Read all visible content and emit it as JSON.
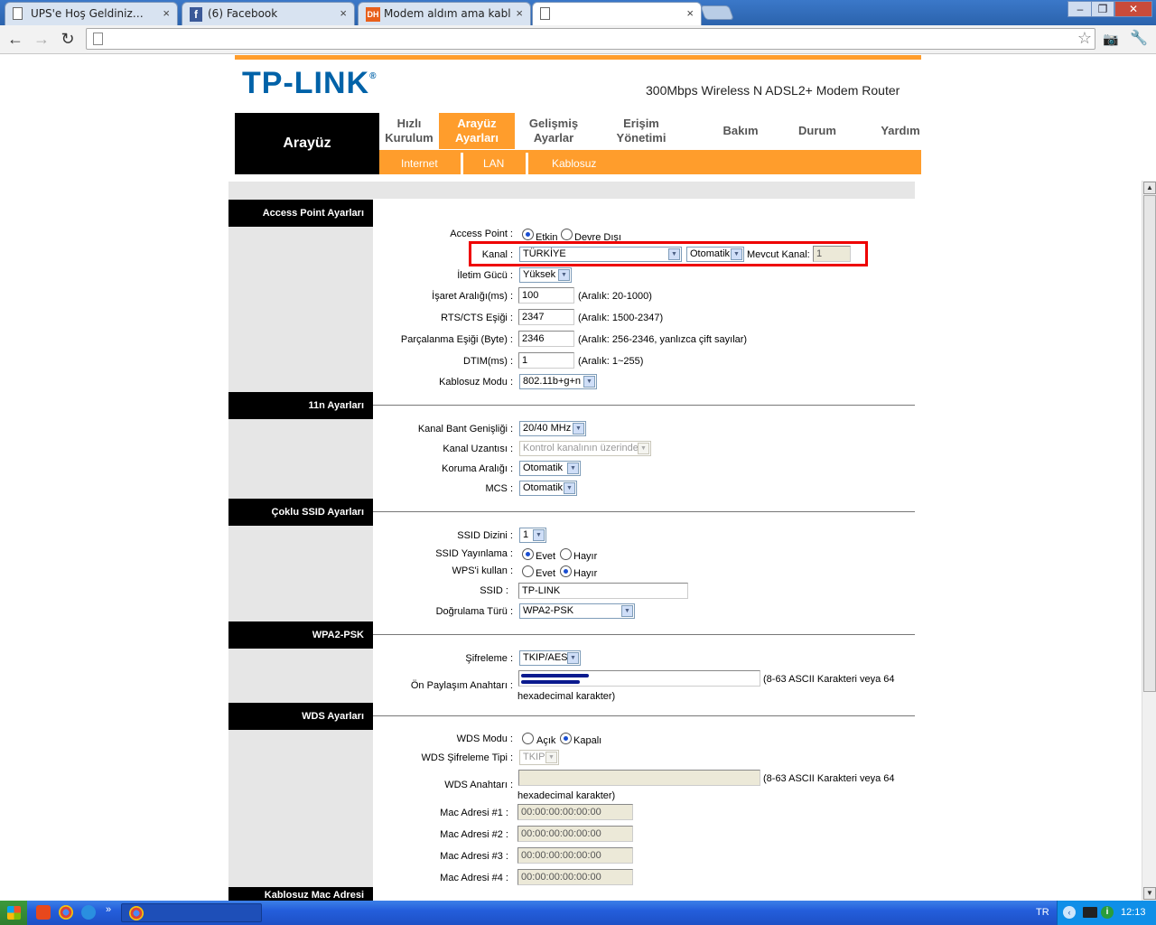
{
  "browser": {
    "tabs": [
      {
        "title": "UPS'e Hoş Geldiniz…",
        "close": "×"
      },
      {
        "title": "(6) Facebook",
        "close": "×"
      },
      {
        "title": "Modem aldım ama kablosuz o",
        "close": "×"
      },
      {
        "title": "",
        "close": "×"
      }
    ],
    "window_buttons": [
      "–",
      "❐",
      "✕"
    ],
    "back": "←",
    "forward": "→",
    "reload": "↻",
    "address": "",
    "star": "☆"
  },
  "router": {
    "logo": "TP-LINK",
    "logo_mark": "®",
    "model": "300Mbps Wireless N ADSL2+ Modem Router",
    "section_title": "Arayüz",
    "menu": [
      {
        "l1": "Hızlı",
        "l2": "Kurulum"
      },
      {
        "l1": "Arayüz",
        "l2": "Ayarları"
      },
      {
        "l1": "Gelişmiş",
        "l2": "Ayarlar"
      },
      {
        "l1": "Erişim",
        "l2": "Yönetimi"
      },
      {
        "l1": "Bakım"
      },
      {
        "l1": "Durum"
      },
      {
        "l1": "Yardım"
      }
    ],
    "submenu": [
      "Internet",
      "LAN",
      "Kablosuz"
    ]
  },
  "sections": {
    "access_point": "Access Point Ayarları",
    "n11": "11n Ayarları",
    "multi_ssid": "Çoklu SSID Ayarları",
    "wpa2": "WPA2-PSK",
    "wds": "WDS Ayarları",
    "mac": "Kablosuz Mac Adresi"
  },
  "ap": {
    "access_point_label": "Access Point :",
    "opt_on": "Etkin",
    "opt_off": "Devre Dışı",
    "kanal_label": "Kanal :",
    "kanal_value": "TÜRKİYE",
    "kanal_mode": "Otomatik",
    "current_channel_label": "Mevcut Kanal:",
    "current_channel_value": "1",
    "power_label": "İletim Gücü :",
    "power_value": "Yüksek",
    "beacon_label": "İşaret Aralığı(ms) :",
    "beacon_value": "100",
    "beacon_hint": "(Aralık: 20-1000)",
    "rts_label": "RTS/CTS Eşiği :",
    "rts_value": "2347",
    "rts_hint": "(Aralık: 1500-2347)",
    "frag_label": "Parçalanma Eşiği (Byte) :",
    "frag_value": "2346",
    "frag_hint": "(Aralık: 256-2346, yanlızca çift sayılar)",
    "dtim_label": "DTIM(ms) :",
    "dtim_value": "1",
    "dtim_hint": "(Aralık: 1~255)",
    "mode_label": "Kablosuz Modu :",
    "mode_value": "802.11b+g+n"
  },
  "n11": {
    "bw_label": "Kanal Bant Genişliği :",
    "bw_value": "20/40 MHz",
    "ext_label": "Kanal Uzantısı :",
    "ext_value": "Kontrol kanalının üzerinde",
    "guard_label": "Koruma Aralığı :",
    "guard_value": "Otomatik",
    "mcs_label": "MCS :",
    "mcs_value": "Otomatik"
  },
  "ssid": {
    "index_label": "SSID Dizini :",
    "index_value": "1",
    "broadcast_label": "SSID Yayınlama :",
    "yes": "Evet",
    "no": "Hayır",
    "wps_label": "WPS'i kullan :",
    "ssid_label": "SSID :",
    "ssid_value": "TP-LINK",
    "auth_label": "Doğrulama Türü :",
    "auth_value": "WPA2-PSK"
  },
  "wpa": {
    "enc_label": "Şifreleme :",
    "enc_value": "TKIP/AES",
    "psk_label": "Ön Paylaşım Anahtarı :",
    "psk_hint1": "(8-63 ASCII Karakteri veya 64",
    "psk_hint2": "hexadecimal karakter)"
  },
  "wds": {
    "mode_label": "WDS Modu :",
    "open": "Açık",
    "closed": "Kapalı",
    "enc_label": "WDS Şifreleme Tipi :",
    "enc_value": "TKIP",
    "key_label": "WDS Anahtarı :",
    "key_hint1": "(8-63 ASCII Karakteri veya 64",
    "key_hint2": "hexadecimal karakter)",
    "mac1_label": "Mac Adresi #1 :",
    "mac1": "00:00:00:00:00:00",
    "mac2_label": "Mac Adresi #2 :",
    "mac2": "00:00:00:00:00:00",
    "mac3_label": "Mac Adresi #3 :",
    "mac3": "00:00:00:00:00:00",
    "mac4_label": "Mac Adresi #4 :",
    "mac4": "00:00:00:00:00:00"
  },
  "taskbar": {
    "lang": "TR",
    "clock": "12:13"
  }
}
